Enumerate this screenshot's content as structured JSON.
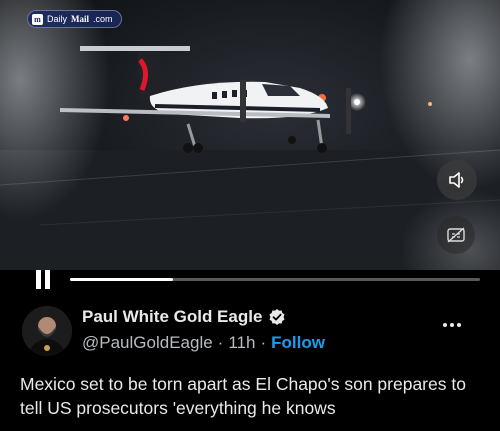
{
  "video": {
    "watermark": {
      "logo_letter": "m",
      "brand_light": "Daily",
      "brand_bold": "Mail",
      "brand_suffix": ".com"
    },
    "progress": 0.25,
    "controls": {
      "pause_icon": "pause-icon",
      "volume_icon": "volume-icon",
      "captions_icon": "captions-off-icon"
    }
  },
  "tweet": {
    "author": {
      "display_name": "Paul White Gold Eagle",
      "handle": "@PaulGoldEagle",
      "verified": true
    },
    "separator": "·",
    "time": "11h",
    "follow_label": "Follow",
    "more_icon": "more-options-icon",
    "text": "Mexico set to be torn apart as El Chapo's son prepares to tell US prosecutors 'everything he knows"
  },
  "colors": {
    "accent": "#1d9bf0",
    "text": "#e7e9ea",
    "muted": "#b8bcc0",
    "background": "#000000"
  }
}
